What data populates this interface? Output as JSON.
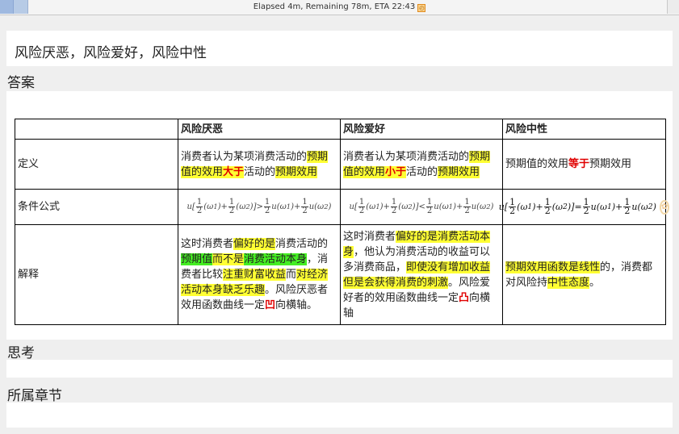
{
  "status_bar": {
    "text": "Elapsed 4m, Remaining 78m, ETA 22:43",
    "progress_fraction": 0.04
  },
  "question": {
    "text": "风险厌恶，风险爱好，风险中性"
  },
  "sections": {
    "answer": "答案",
    "thinking": "思考",
    "chapter": "所属章节"
  },
  "table": {
    "headers": [
      "",
      "风险厌恶",
      "风险爱好",
      "风险中性"
    ],
    "rows": {
      "definition": {
        "label": "定义",
        "averse": {
          "t1": "消费者认为某项消费活动的",
          "t2": "预期值的效用",
          "t3": "大于",
          "t4": "活动的",
          "t5": "预期效用"
        },
        "loving": {
          "t1": "消费者认为某项消费活动的",
          "t2": "预期值的效用",
          "t3": "小于",
          "t4": "活动的",
          "t5": "预期效用"
        },
        "neutral": {
          "t1": "预期值的效用",
          "t2": "等于",
          "t3": "预期效用"
        }
      },
      "formula": {
        "label": "条件公式",
        "averse_relation": ">",
        "loving_relation": "<",
        "neutral_relation": "="
      },
      "explanation": {
        "label": "解释",
        "averse": {
          "t1": "这时消费者",
          "t2": "偏好的是",
          "t3": "消费活动的",
          "t4": "预期值",
          "t5": "而不是",
          "t6": "消费活动本身",
          "t7": "，消费者比较",
          "t8": "注重财富收益",
          "t9": "而",
          "t10": "对经济活动本身缺乏乐趣",
          "t11": "。风险厌恶者效用函数曲线一定",
          "t12": "凹",
          "t13": "向横轴。"
        },
        "loving": {
          "t1": "这时消费者",
          "t2": "偏好的是",
          "t3": "消费活动本身",
          "t4": "，他认为消费活动的收益可以多消费商品，",
          "t5": "即使没有增加收益但是会获得消费的刺激",
          "t6": "。风险爱好者的效用函数曲线一定",
          "t7": "凸",
          "t8": "向横轴"
        },
        "neutral": {
          "t1": "预期效用函数是线性",
          "t2": "的，消费都对风险持",
          "t3": "中性态度",
          "t4": "。"
        }
      }
    }
  }
}
